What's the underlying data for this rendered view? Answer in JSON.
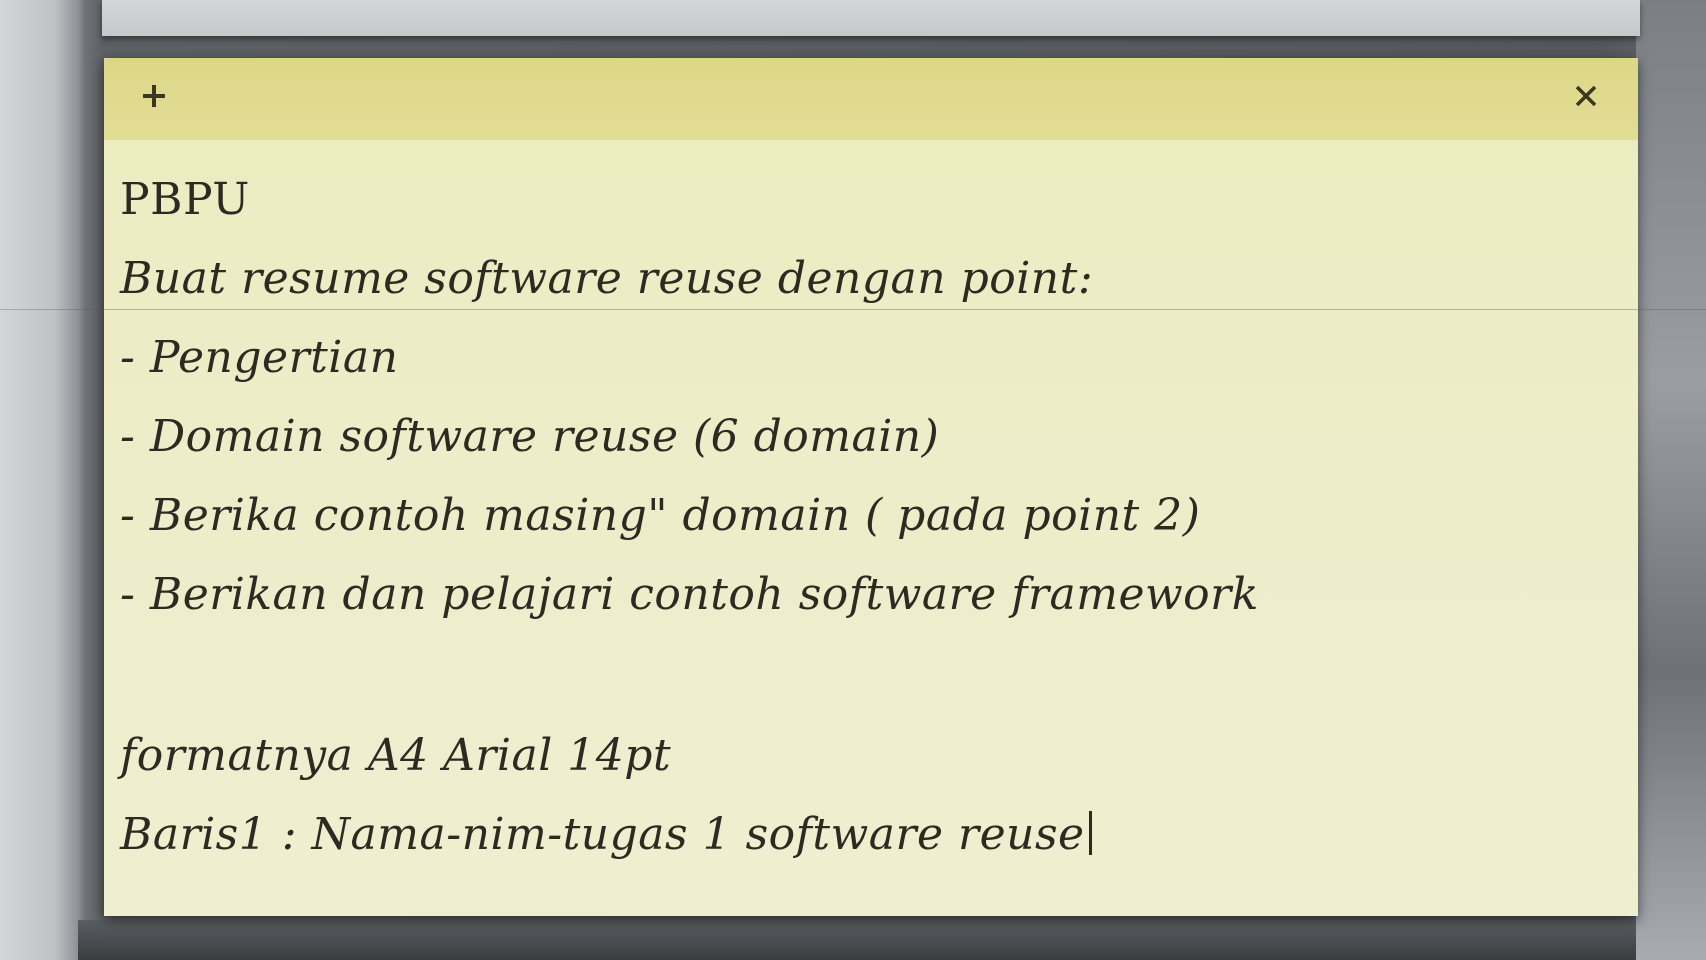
{
  "note": {
    "header": {
      "add_icon": "plus-icon",
      "close_icon": "close-icon"
    },
    "lines": [
      "PBPU",
      "Buat resume software reuse dengan point:",
      "- Pengertian",
      "- Domain software reuse (6 domain)",
      "- Berika contoh masing\" domain ( pada point 2)",
      "- Berikan dan pelajari contoh software framework",
      "",
      "formatnya A4 Arial 14pt",
      "Baris1 : Nama-nim-tugas 1 software reuse"
    ],
    "colors": {
      "header": "#dcd787",
      "body": "#eeedc9",
      "text": "#2d2a22"
    }
  }
}
